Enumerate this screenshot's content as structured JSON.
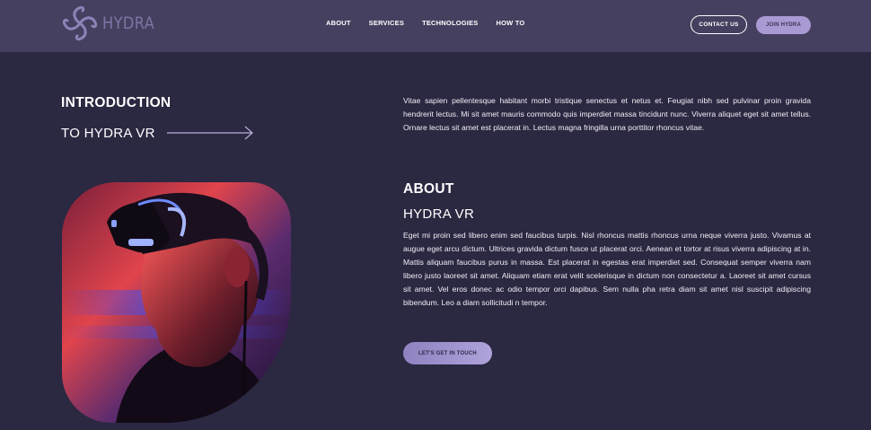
{
  "header": {
    "logo_text": "HYDRA",
    "nav": [
      "ABOUT",
      "SERVICES",
      "TECHNOLOGIES",
      "HOW TO"
    ],
    "contact_label": "CONTACT US",
    "join_label": "JOIN HYDRA"
  },
  "intro": {
    "title": "INTRODUCTION",
    "subtitle": "TO HYDRA VR",
    "paragraph": "Vitae sapien pellentesque habitant morbi tristique senectus et netus et. Feugiat nibh sed pulvinar proin gravida hendrerit lectus. Mi sit amet mauris commodo quis imperdiet massa tincidunt nunc. Viverra aliquet eget sit amet tellus. Ornare lectus sit amet est placerat in. Lectus magna fringilla urna porttitor rhoncus vitae."
  },
  "about": {
    "title": "ABOUT",
    "subtitle": "HYDRA VR",
    "paragraph": "Eget mi proin sed libero enim sed faucibus turpis. Nisl rhoncus mattis rhoncus urna neque viverra justo. Vivamus at augue eget arcu dictum. Ultrices gravida dictum fusce ut placerat orci. Aenean et tortor at risus viverra adipiscing at in. Mattis aliquam faucibus purus in massa. Est placerat in egestas erat imperdiet sed. Consequat semper viverra nam libero justo laoreet sit amet. Aliquam etiam erat velit scelerisque in dictum non consectetur a. Laoreet sit amet cursus sit amet. Vel eros donec ac odio tempor orci dapibus. Sem nulla pha retra diam sit amet nisl suscipit adipiscing bibendum. Leo a diam sollicitudi n tempor.",
    "cta_label": "LET'S GET IN TOUCH"
  },
  "colors": {
    "background": "#2b2841",
    "header": "#45405f",
    "accent": "#a99ad4"
  }
}
